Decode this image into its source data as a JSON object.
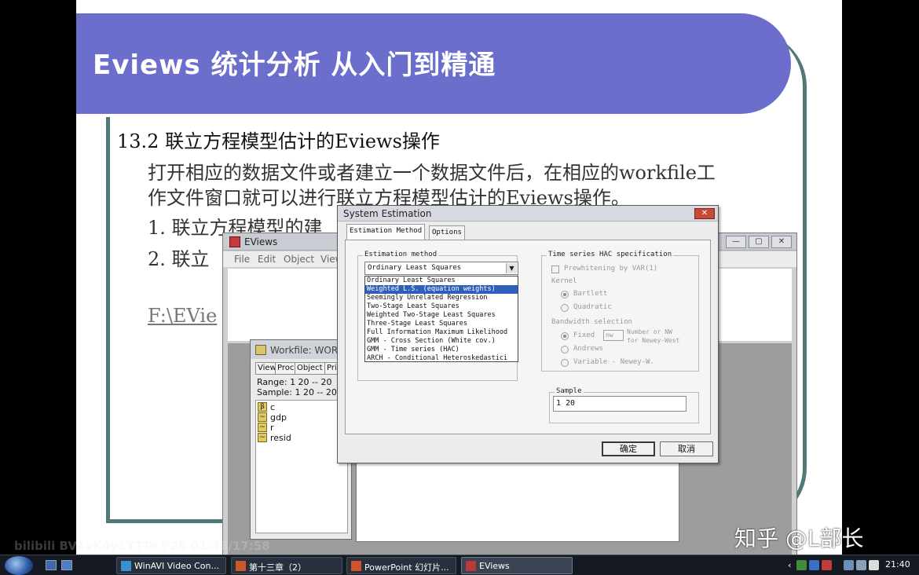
{
  "slide": {
    "title": "Eviews 统计分析 从入门到精通",
    "section_heading": "13.2 联立方程模型估计的Eviews操作",
    "body_line1": "打开相应的数据文件或者建立一个数据文件后，在相应的workfile工",
    "body_line2": "作文件窗口就可以进行联立方程模型估计的Eviews操作。",
    "item1": "1. 联立方程模型的建",
    "item2": "2. 联立",
    "file_link": "F:\\EVie"
  },
  "eviews": {
    "title": "EViews",
    "menu": [
      "File",
      "Edit",
      "Object",
      "View"
    ],
    "controls": {
      "minimize": "—",
      "maximize": "▢",
      "close": "✕"
    }
  },
  "workfile": {
    "title": "Workfile: WORK",
    "buttons": [
      "View",
      "Proc",
      "Object",
      "Prin"
    ],
    "range": "Range: 1 20  --  20",
    "sample": "Sample: 1 20  --  20",
    "objects": [
      {
        "icon": "β",
        "name": "c"
      },
      {
        "icon": "~",
        "name": "gdp"
      },
      {
        "icon": "~",
        "name": "r"
      },
      {
        "icon": "~",
        "name": "resid"
      }
    ]
  },
  "dialog": {
    "title": "System Estimation",
    "close_label": "✕",
    "tabs": [
      "Estimation Method",
      "Options"
    ],
    "estimation_method_label": "Estimation method",
    "combo_value": "Ordinary Least Squares",
    "combo_arrow": "▼",
    "dropdown_items": [
      "Ordinary Least Squares",
      "Weighted L.S. (equation weights)",
      "Seemingly Unrelated Regression",
      "Two-Stage Least Squares",
      "Weighted Two-Stage Least Squares",
      "Three-Stage Least Squares",
      "Full Information Maximum Likelihood",
      "GMM - Cross Section (White cov.)",
      "GMM - Time series (HAC)",
      "ARCH - Conditional Heteroskedastici"
    ],
    "selected_index": 1,
    "hac_label": "Time series HAC specification",
    "prewhitening": "Prewhitening by VAR(1)",
    "kernel_label": "Kernel",
    "kernel_options": [
      "Bartlett",
      "Quadratic"
    ],
    "bandwidth_label": "Bandwidth selection",
    "bandwidth_fixed": "Fixed",
    "bandwidth_fixed_value": "nw",
    "bandwidth_note_1": "Number or NW",
    "bandwidth_note_2": "for Newey-West",
    "bandwidth_andrews": "Andrews",
    "bandwidth_variable": "Variable - Newey-W.",
    "sample_label": "Sample",
    "sample_value": "1 20",
    "ok_label": "确定",
    "cancel_label": "取消"
  },
  "overlay": {
    "watermark": "bilibili  BV1vK4y1YTTe P26 01:48/17:58",
    "zhihu": "知乎 @L部长"
  },
  "taskbar": {
    "tasks": [
      "WinAVI Video Con...",
      "第十三章（2）",
      "PowerPoint 幻灯片...",
      "EViews"
    ],
    "active_index": 3,
    "tray_arrow": "‹",
    "clock": "21:40"
  },
  "colors": {
    "title_band": "#6b6ecb",
    "frame_teal": "#4f7a78",
    "selection": "#2f5fbd"
  }
}
